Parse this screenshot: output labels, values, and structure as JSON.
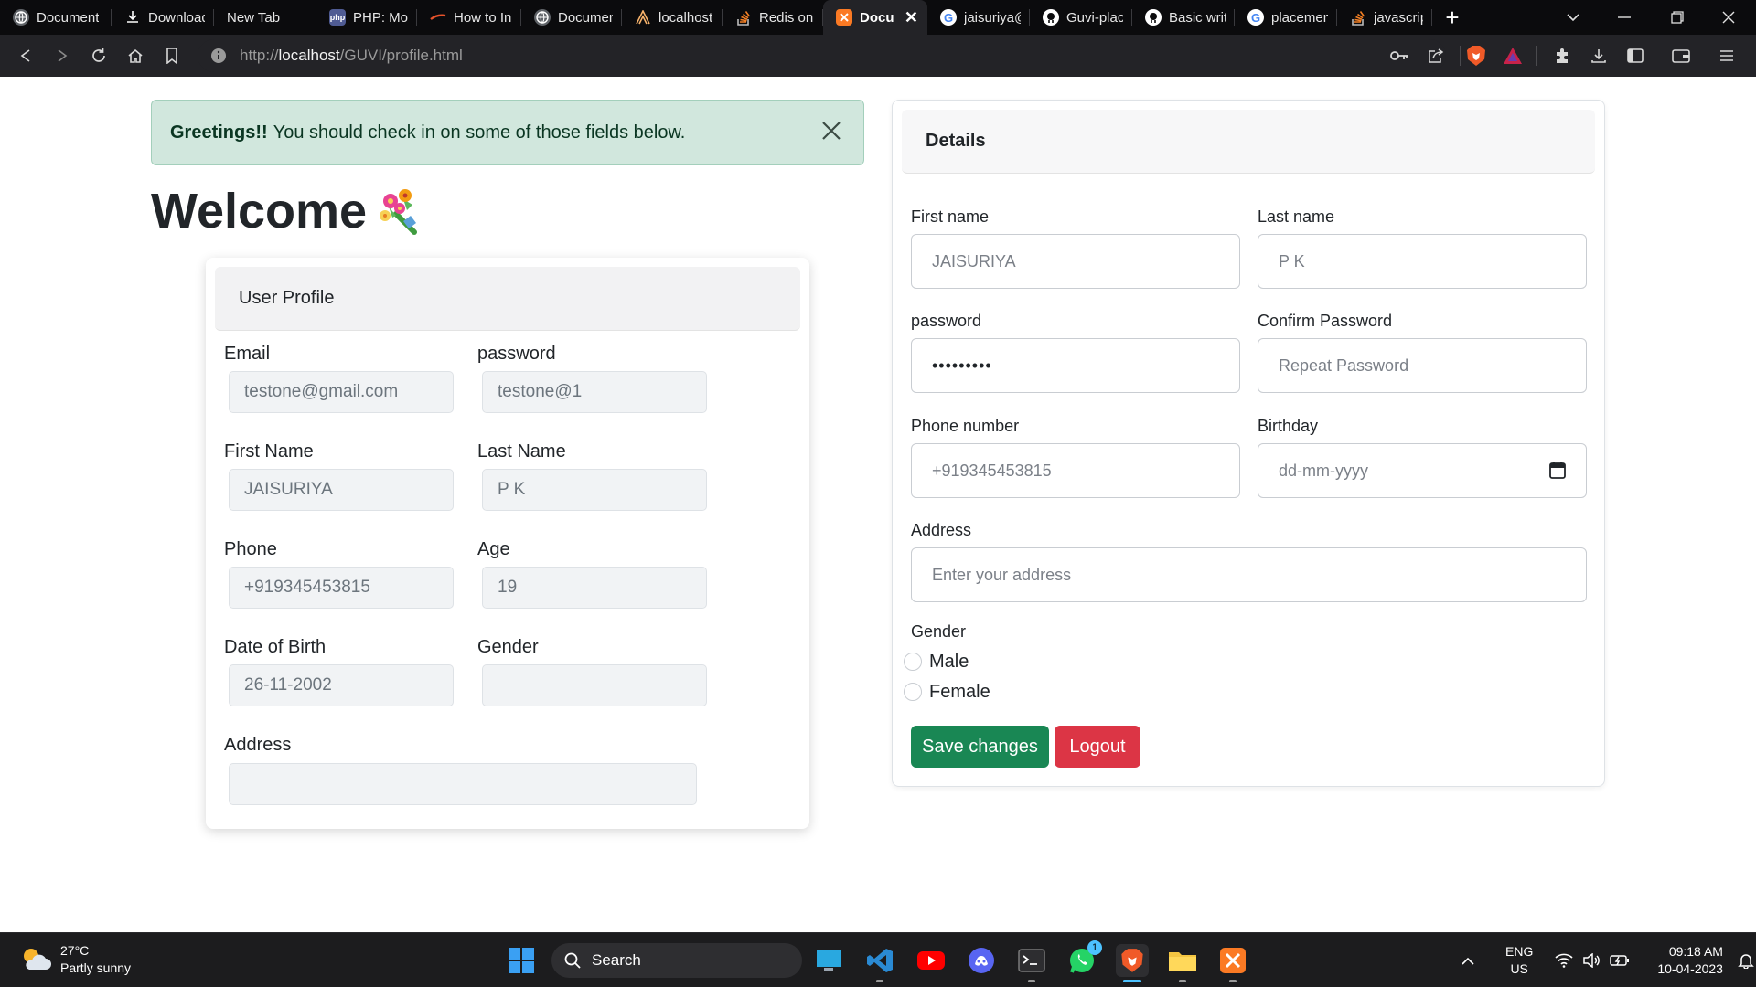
{
  "browser": {
    "tabs": [
      {
        "title": "Document",
        "icon": "globe-icon",
        "active": false
      },
      {
        "title": "Download",
        "icon": "download-icon",
        "active": false
      },
      {
        "title": "New Tab",
        "icon": "none",
        "active": false
      },
      {
        "title": "PHP: Mon",
        "icon": "php-icon",
        "active": false
      },
      {
        "title": "How to In",
        "icon": "stroke-icon",
        "active": false
      },
      {
        "title": "Document",
        "icon": "globe-icon",
        "active": false
      },
      {
        "title": "localhost",
        "icon": "xampp-logo-icon",
        "active": false
      },
      {
        "title": "Redis on",
        "icon": "stackoverflow-icon",
        "active": false
      },
      {
        "title": "Docun",
        "icon": "xampp-icon",
        "active": true
      },
      {
        "title": "jaisuriya@",
        "icon": "google-icon",
        "active": false
      },
      {
        "title": "Guvi-plac",
        "icon": "github-icon",
        "active": false
      },
      {
        "title": "Basic writ",
        "icon": "github-icon",
        "active": false
      },
      {
        "title": "placemen",
        "icon": "google-icon",
        "active": false
      },
      {
        "title": "javascript",
        "icon": "stackoverflow-icon",
        "active": false
      }
    ],
    "url_prefix": "http://",
    "url_host": "localhost",
    "url_path": "/GUVI/profile.html",
    "accent": "#f05a28"
  },
  "alert": {
    "strong": "Greetings!!",
    "message": "You should check in on some of those fields below.",
    "bg_color": "#d1e7dd"
  },
  "welcome": {
    "title": "Welcome"
  },
  "profile": {
    "header": "User Profile",
    "email_label": "Email",
    "email_value": "testone@gmail.com",
    "password_label": "password",
    "password_value": "testone@1",
    "first_name_label": "First Name",
    "first_name_value": "JAISURIYA",
    "last_name_label": "Last Name",
    "last_name_value": "P K",
    "phone_label": "Phone",
    "phone_value": "+919345453815",
    "age_label": "Age",
    "age_value": "19",
    "dob_label": "Date of Birth",
    "dob_value": "26-11-2002",
    "gender_label": "Gender",
    "gender_value": "",
    "address_label": "Address",
    "address_value": ""
  },
  "details": {
    "header": "Details",
    "first_name_label": "First name",
    "first_name_value": "JAISURIYA",
    "last_name_label": "Last name",
    "last_name_value": "P K",
    "password_label": "password",
    "password_value": "•••••••••",
    "confirm_label": "Confirm Password",
    "confirm_placeholder": "Repeat Password",
    "phone_label": "Phone number",
    "phone_value": "+919345453815",
    "birthday_label": "Birthday",
    "birthday_placeholder": "dd-mm-yyyy",
    "address_label": "Address",
    "address_placeholder": "Enter your address",
    "gender_label": "Gender",
    "gender_options": [
      "Male",
      "Female"
    ],
    "save_label": "Save changes",
    "logout_label": "Logout",
    "save_color": "#198754",
    "logout_color": "#dc3545"
  },
  "taskbar": {
    "temperature": "27°C",
    "weather": "Partly sunny",
    "search_label": "Search",
    "whatsapp_badge": "1",
    "lang_line1": "ENG",
    "lang_line2": "US",
    "time": "09:18 AM",
    "date": "10-04-2023"
  }
}
